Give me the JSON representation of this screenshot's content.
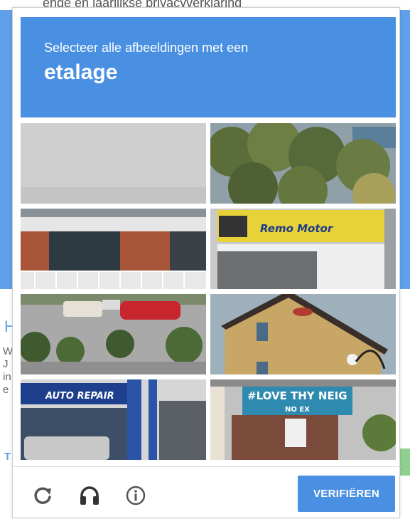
{
  "background_page": {
    "top_text": "enge en jaarlijkse privacyverklaring",
    "heading_letter": "H",
    "body_lines": [
      "W",
      "J",
      "in",
      "e"
    ],
    "link_letter": "T"
  },
  "captcha": {
    "instruction": "Selecteer alle afbeeldingen met een",
    "keyword": "etalage",
    "tiles": [
      {
        "content": "grey wall"
      },
      {
        "content": "trees"
      },
      {
        "content": "brick building with fence"
      },
      {
        "content": "motor shop storefront",
        "sign_text": "Remo Motor"
      },
      {
        "content": "parking lot with cars"
      },
      {
        "content": "yellow building with lamp"
      },
      {
        "content": "auto repair shop",
        "sign_text": "AUTO REPAIR"
      },
      {
        "content": "building with banner",
        "sign_text": "#LOVE THY NEIG",
        "sub_text": "NO EX"
      }
    ],
    "footer": {
      "reload_icon": "reload-icon",
      "audio_icon": "headphones-icon",
      "info_icon": "info-icon",
      "verify_label": "VERIFIËREN"
    },
    "colors": {
      "accent": "#4a90e2",
      "icon": "#555555"
    }
  }
}
